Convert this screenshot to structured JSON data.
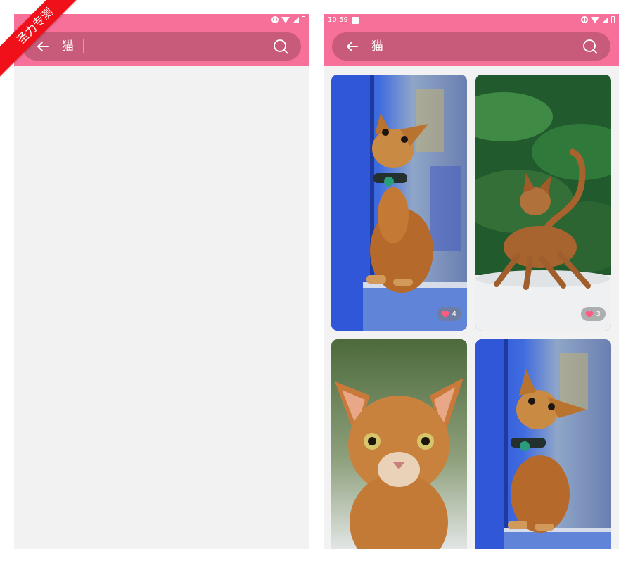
{
  "ribbon": {
    "text": "圣力专测"
  },
  "left_screen": {
    "search": {
      "query": "猫"
    }
  },
  "right_screen": {
    "status_bar": {
      "time": "10:59"
    },
    "search": {
      "query": "猫"
    },
    "results": [
      {
        "likes": "4",
        "photo": "abyssinian-cat-looking-up-by-blue-wall"
      },
      {
        "likes": "3",
        "photo": "abyssinian-cat-walking-with-tail-up-by-ferns"
      },
      {
        "photo": "abyssinian-kitten-front-face"
      },
      {
        "photo": "abyssinian-cat-looking-up-by-blue-wall"
      }
    ]
  },
  "colors": {
    "app_bar": "#f77099",
    "search_field": "#c85b79",
    "background": "#f2f2f2",
    "accent_heart": "#ff5a82"
  }
}
